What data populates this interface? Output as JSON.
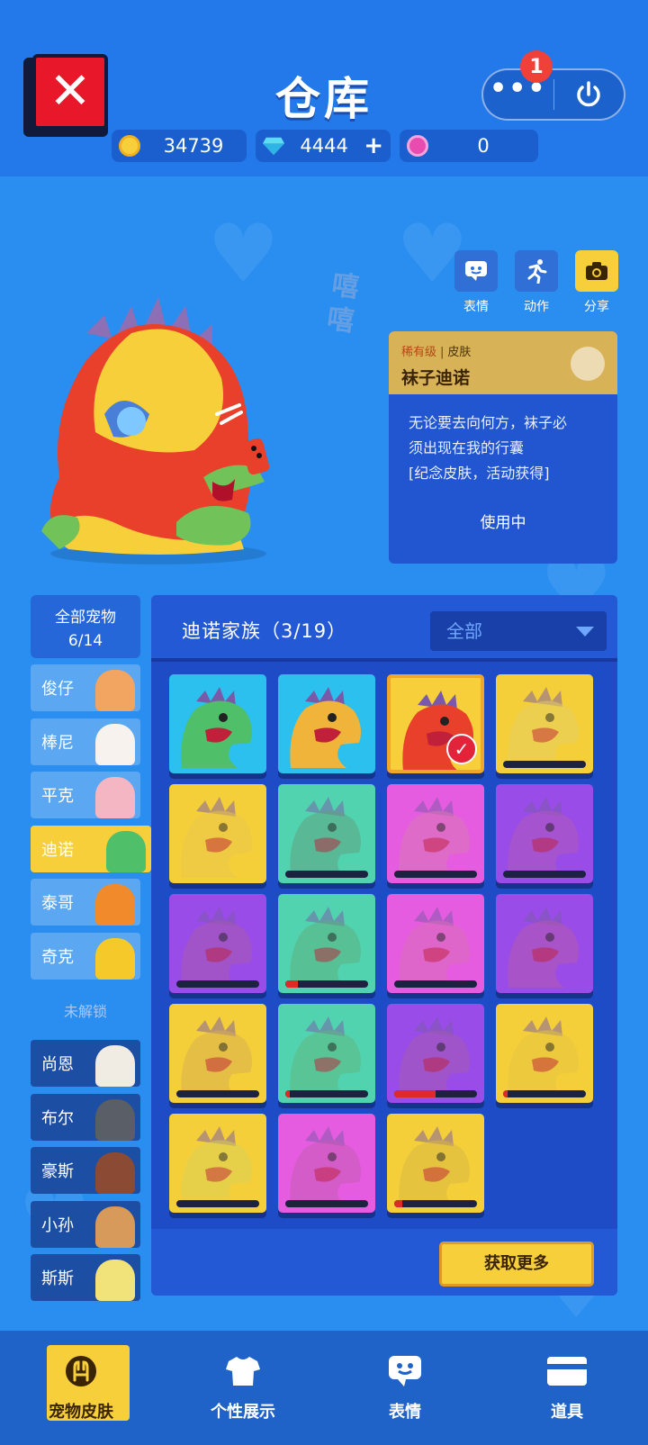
{
  "header": {
    "title": "仓库",
    "close_icon": "close-x-icon",
    "notification_count": "1",
    "more_label": "•••",
    "power_icon": "power-icon"
  },
  "currency": {
    "coins": "34739",
    "diamonds": "4444",
    "diamonds_add": "+",
    "tokens": "0"
  },
  "actions": [
    {
      "label": "表情",
      "icon": "emoji-chat-icon"
    },
    {
      "label": "动作",
      "icon": "running-man-icon"
    },
    {
      "label": "分享",
      "icon": "camera-icon"
    }
  ],
  "decor_text": "嘻嘻",
  "skin": {
    "rarity": "稀有级",
    "separator": "|",
    "type": "皮肤",
    "name": "袜子迪诺",
    "description_line1": "无论要去向何方，袜子必",
    "description_line2": "须出现在我的行囊",
    "description_line3": "[纪念皮肤，活动获得]",
    "status": "使用中"
  },
  "pets": {
    "all_label": "全部宠物",
    "all_count": "6/14",
    "locked_label": "未解锁",
    "unlocked": [
      {
        "name": "俊仔",
        "color": "#f2a560"
      },
      {
        "name": "棒尼",
        "color": "#f7f2ee"
      },
      {
        "name": "平克",
        "color": "#f4b6c2"
      },
      {
        "name": "迪诺",
        "color": "#4fbf6a"
      },
      {
        "name": "泰哥",
        "color": "#f08a2a"
      },
      {
        "name": "奇克",
        "color": "#f5c92a"
      }
    ],
    "locked": [
      {
        "name": "尚恩",
        "color": "#f0ece4"
      },
      {
        "name": "布尔",
        "color": "#5a5e66"
      },
      {
        "name": "豪斯",
        "color": "#8a4a34"
      },
      {
        "name": "小孙",
        "color": "#d89a5a"
      },
      {
        "name": "斯斯",
        "color": "#f2e27a"
      }
    ]
  },
  "panel": {
    "title": "迪诺家族（3/19）",
    "filter": "全部",
    "get_more": "获取更多"
  },
  "skins": [
    {
      "bg": "#2cc0ee",
      "body": "#4fbf6a",
      "owned": true,
      "progress": null
    },
    {
      "bg": "#2cc0ee",
      "body": "#f0b43a",
      "owned": true,
      "progress": null
    },
    {
      "bg": "#f7cf3a",
      "body": "#e8402a",
      "owned": true,
      "selected": true,
      "progress": null
    },
    {
      "bg": "#f5cf3a",
      "body": "#e6d064",
      "owned": false,
      "progress": 0
    },
    {
      "bg": "#f5cf3a",
      "body": "#e9c64c",
      "owned": false,
      "progress": null
    },
    {
      "bg": "#52d3b0",
      "body": "#5fa07c",
      "owned": false,
      "progress": 0
    },
    {
      "bg": "#e65ce0",
      "body": "#d87ab0",
      "owned": false,
      "progress": 0
    },
    {
      "bg": "#9a4ce8",
      "body": "#b05ab6",
      "owned": false,
      "progress": 0
    },
    {
      "bg": "#9a4ce8",
      "body": "#a65ca8",
      "owned": false,
      "progress": 0
    },
    {
      "bg": "#52d3b0",
      "body": "#5bb07a",
      "owned": false,
      "progress": 0.15
    },
    {
      "bg": "#e65ce0",
      "body": "#d670b4",
      "owned": false,
      "progress": 0
    },
    {
      "bg": "#9a4ce8",
      "body": "#b65aa8",
      "owned": false,
      "progress": null
    },
    {
      "bg": "#f5cf3a",
      "body": "#d6ae52",
      "owned": false,
      "progress": 0
    },
    {
      "bg": "#52d3b0",
      "body": "#60b57a",
      "owned": false,
      "progress": 0.05
    },
    {
      "bg": "#9a4ce8",
      "body": "#a45cac",
      "owned": false,
      "progress": 0.5
    },
    {
      "bg": "#f5cf3a",
      "body": "#e6c640",
      "owned": false,
      "progress": 0.05
    },
    {
      "bg": "#f5cf3a",
      "body": "#d8d25a",
      "owned": false,
      "progress": 0
    },
    {
      "bg": "#e65ce0",
      "body": "#c05cb0",
      "owned": false,
      "progress": 0
    },
    {
      "bg": "#f5cf3a",
      "body": "#d8b842",
      "owned": false,
      "progress": 0.1
    }
  ],
  "bottom_nav": [
    {
      "label": "宠物皮肤",
      "icon": "pet-paw-icon",
      "active": true
    },
    {
      "label": "个性展示",
      "icon": "tshirt-icon",
      "active": false
    },
    {
      "label": "表情",
      "icon": "emoji-chat-icon",
      "active": false
    },
    {
      "label": "道具",
      "icon": "card-icon",
      "active": false
    }
  ],
  "colors": {
    "background": "#2a8ef0",
    "header": "#2379ea",
    "accent_yellow": "#f7cf3a",
    "close_red": "#e8182a"
  }
}
